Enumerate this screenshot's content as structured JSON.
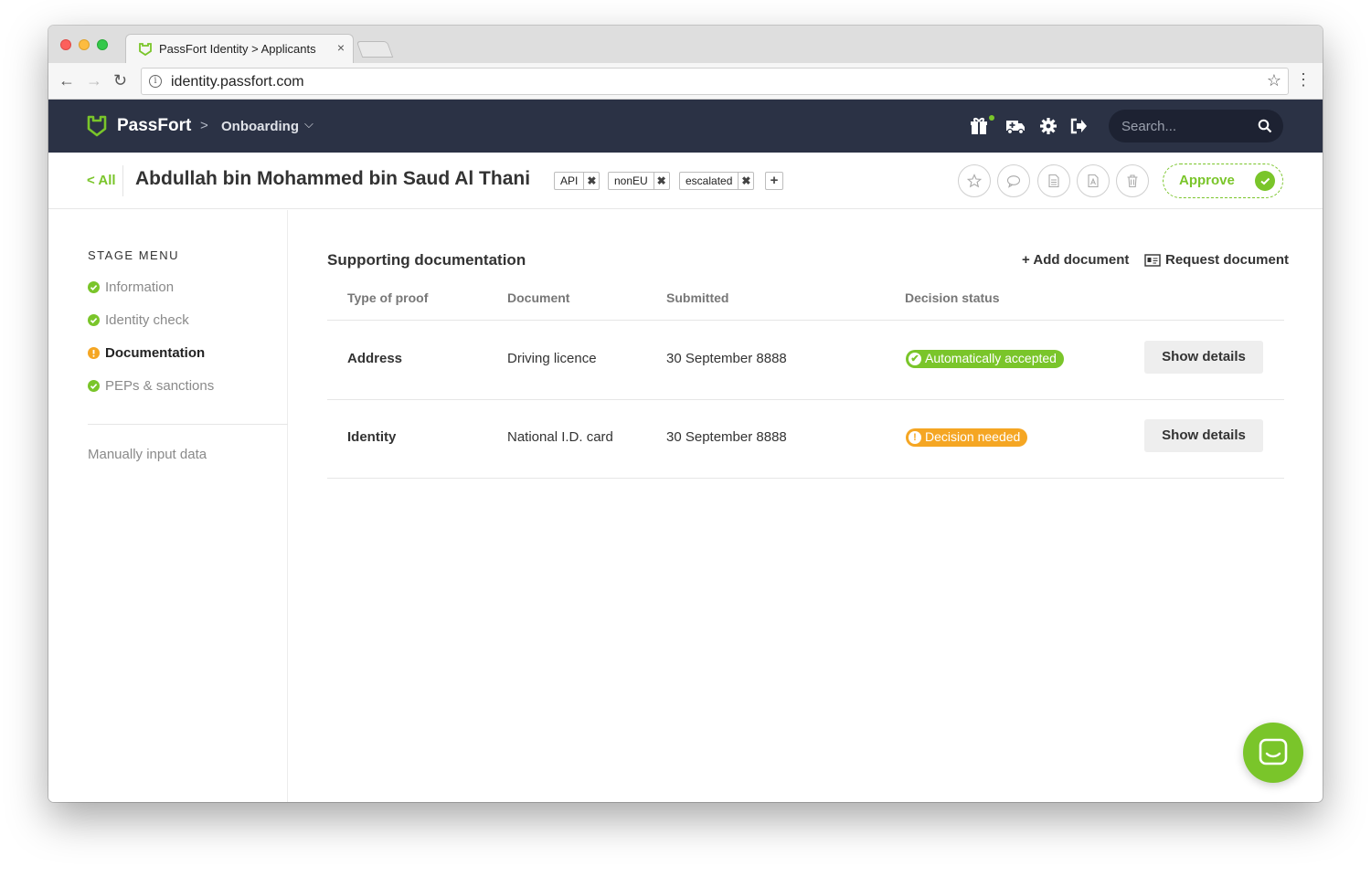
{
  "browser": {
    "tab_title": "PassFort Identity > Applicants",
    "tab_close": "×",
    "url": "identity.passfort.com",
    "nav_back": "←",
    "nav_forward": "→",
    "nav_reload": "↻",
    "bookmark_star": "☆",
    "menu": "⋮"
  },
  "header": {
    "logo": "PassFort",
    "breadcrumb_separator": ">",
    "section": "Onboarding",
    "section_chevron": "⌵",
    "search_placeholder": "Search..."
  },
  "applicant": {
    "back_link": "< All",
    "name": "Abdullah bin Mohammed bin Saud Al Thani",
    "tags": [
      {
        "label": "API",
        "remove": "✖"
      },
      {
        "label": "nonEU",
        "remove": "✖"
      },
      {
        "label": "escalated",
        "remove": "✖"
      }
    ],
    "add_tag": "+",
    "approve_label": "Approve"
  },
  "sidebar": {
    "title": "STAGE MENU",
    "items": [
      {
        "label": "Information",
        "status": "ok"
      },
      {
        "label": "Identity check",
        "status": "ok"
      },
      {
        "label": "Documentation",
        "status": "warning"
      },
      {
        "label": "PEPs & sanctions",
        "status": "ok"
      }
    ],
    "manual_link": "Manually input data"
  },
  "main": {
    "title": "Supporting documentation",
    "add_document": "+ Add document",
    "request_document": "Request document",
    "columns": [
      "Type of proof",
      "Document",
      "Submitted",
      "Decision status"
    ],
    "rows": [
      {
        "type": "Address",
        "document": "Driving licence",
        "submitted": "30 September 8888",
        "status": "Automatically accepted",
        "status_icon": "✔",
        "action": "Show details"
      },
      {
        "type": "Identity",
        "document": "National I.D. card",
        "submitted": "30 September 8888",
        "status": "Decision needed",
        "status_icon": "!",
        "action": "Show details"
      }
    ]
  },
  "colors": {
    "brand_green": "#7ac52a",
    "warning_orange": "#f5a623",
    "navbar": "#2b3245"
  }
}
